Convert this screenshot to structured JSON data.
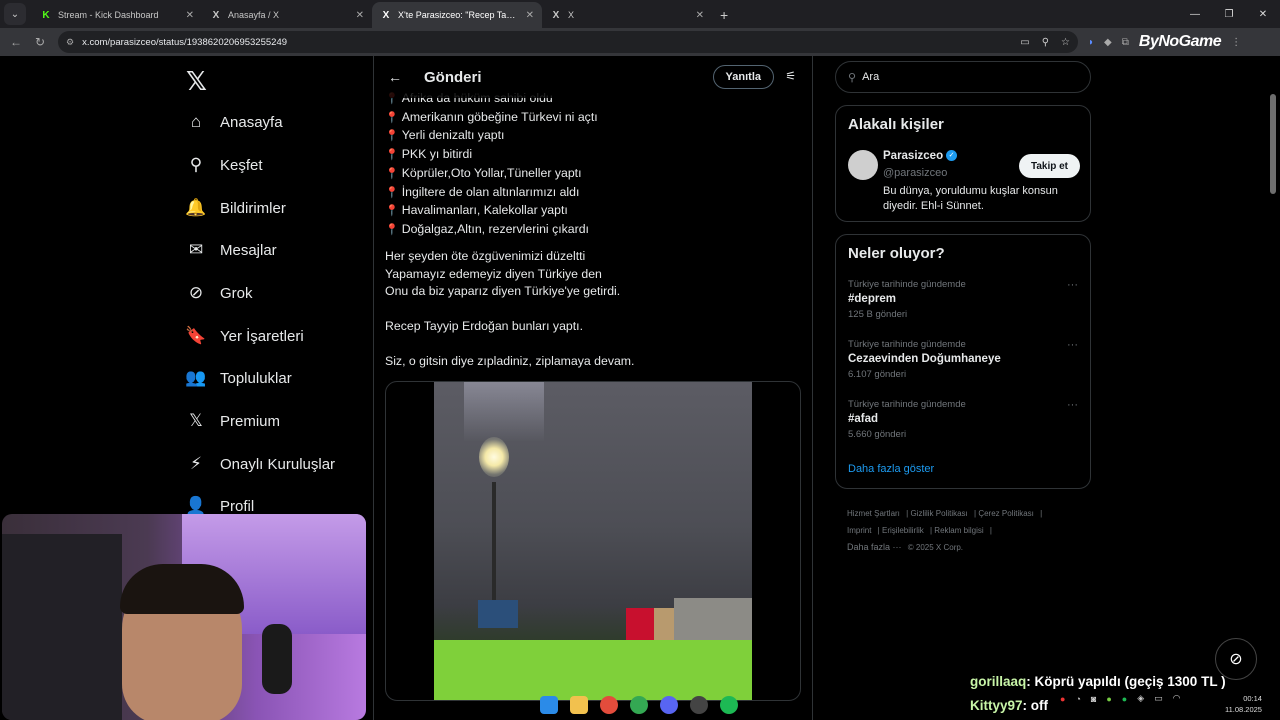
{
  "browser": {
    "tabs": [
      {
        "label": "Stream - Kick Dashboard",
        "icon": "K"
      },
      {
        "label": "Anasayfa / X",
        "icon": "X"
      },
      {
        "label": "X'te Parasizceo: \"Recep Tayyip",
        "icon": "X"
      },
      {
        "label": "X",
        "icon": "X"
      }
    ],
    "url": "x.com/parasizceo/status/1938620206953255249",
    "ext_brand": "ByNoGame"
  },
  "nav": {
    "items": [
      {
        "label": "Anasayfa",
        "icon": "⌂"
      },
      {
        "label": "Keşfet",
        "icon": "⚲"
      },
      {
        "label": "Bildirimler",
        "icon": "🔔"
      },
      {
        "label": "Mesajlar",
        "icon": "✉"
      },
      {
        "label": "Grok",
        "icon": "⊘"
      },
      {
        "label": "Yer İşaretleri",
        "icon": "🔖"
      },
      {
        "label": "Topluluklar",
        "icon": "👥"
      },
      {
        "label": "Premium",
        "icon": "𝕏"
      },
      {
        "label": "Onaylı Kuruluşlar",
        "icon": "⚡"
      },
      {
        "label": "Profil",
        "icon": "👤"
      }
    ]
  },
  "post": {
    "header_title": "Gönderi",
    "reply_label": "Yanıtla",
    "bullets": [
      "Afrika da hüküm sahibi oldu",
      "Amerikanın göbeğine Türkevi ni açtı",
      "Yerli denizaltı yaptı",
      "PKK yı bitirdi",
      "Köprüler,Oto Yollar,Tüneller yaptı",
      "İngiltere de olan altınlarımızı aldı",
      "Havalimanları, Kalekollar yaptı",
      "Doğalgaz,Altın, rezervlerini çıkardı"
    ],
    "para1_line1": "Her şeyden öte özgüvenimizi düzeltti",
    "para1_line2": "Yapamayız edemeyiz diyen Türkiye den",
    "para1_line3": "Onu da biz yaparız diyen Türkiye'ye getirdi.",
    "para2": "Recep Tayyip Erdoğan bunları yaptı.",
    "para3": "Siz, o gitsin diye zıpladiniz, ziplamaya devam."
  },
  "sidebar": {
    "search_placeholder": "Ara",
    "related_title": "Alakalı kişiler",
    "person_name": "Parasizceo",
    "person_handle": "@parasizceo",
    "person_bio": "Bu dünya, yoruldumu kuşlar konsun diyedir. Ehl-i Sünnet.",
    "follow_label": "Takip et",
    "trends_title": "Neler oluyor?",
    "trends": [
      {
        "context": "Türkiye tarihinde gündemde",
        "tag": "#deprem",
        "count": "125 B gönderi"
      },
      {
        "context": "Türkiye tarihinde gündemde",
        "tag": "Cezaevinden Doğumhaneye",
        "count": "6.107 gönderi"
      },
      {
        "context": "Türkiye tarihinde gündemde",
        "tag": "#afad",
        "count": "5.660 gönderi"
      }
    ],
    "more_label": "Daha fazla göster",
    "footer": {
      "row1": [
        "Hizmet Şartları",
        "Gizlilik Politikası",
        "Çerez Politikası"
      ],
      "row2": [
        "Imprint",
        "Erişilebilirlik",
        "Reklam bilgisi"
      ],
      "more": "Daha fazla ···",
      "copyright": "© 2025 X Corp."
    }
  },
  "chat": {
    "msg1_user": "gorillaaq",
    "msg1_text": ": Köprü yapıldı (geçiş 1300 TL )",
    "msg2_user": "Kittyy97",
    "msg2_text": ": off"
  },
  "clock": {
    "time": "00:14",
    "date": "11.08.2025"
  },
  "colors": {
    "accent": "#1d9bf0",
    "pin": "#f4212e",
    "chat_user": "#c8f5a8"
  }
}
